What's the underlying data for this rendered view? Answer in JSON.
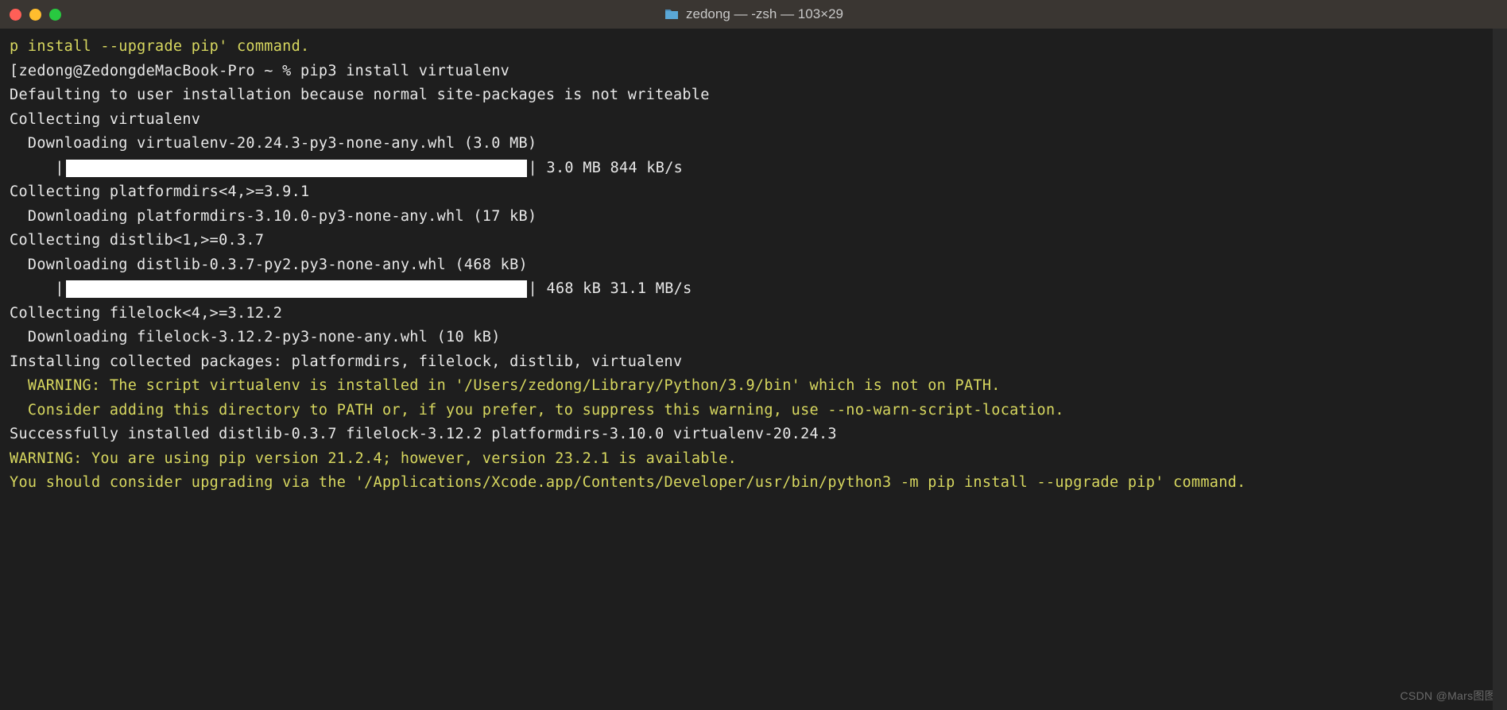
{
  "window": {
    "title": "zedong — -zsh — 103×29"
  },
  "terminal": {
    "lines": [
      {
        "cls": "yellow",
        "text": "p install --upgrade pip' command."
      },
      {
        "cls": "white",
        "text": "[zedong@ZedongdeMacBook-Pro ~ % pip3 install virtualenv"
      },
      {
        "cls": "white",
        "text": "Defaulting to user installation because normal site-packages is not writeable"
      },
      {
        "cls": "white",
        "text": "Collecting virtualenv"
      },
      {
        "cls": "white",
        "text": "  Downloading virtualenv-20.24.3-py3-none-any.whl (3.0 MB)"
      },
      {
        "cls": "white",
        "type": "progress",
        "prefix": "     |",
        "suffix": "| 3.0 MB 844 kB/s"
      },
      {
        "cls": "white",
        "text": "Collecting platformdirs<4,>=3.9.1"
      },
      {
        "cls": "white",
        "text": "  Downloading platformdirs-3.10.0-py3-none-any.whl (17 kB)"
      },
      {
        "cls": "white",
        "text": "Collecting distlib<1,>=0.3.7"
      },
      {
        "cls": "white",
        "text": "  Downloading distlib-0.3.7-py2.py3-none-any.whl (468 kB)"
      },
      {
        "cls": "white",
        "type": "progress",
        "prefix": "     |",
        "suffix": "| 468 kB 31.1 MB/s"
      },
      {
        "cls": "white",
        "text": "Collecting filelock<4,>=3.12.2"
      },
      {
        "cls": "white",
        "text": "  Downloading filelock-3.12.2-py3-none-any.whl (10 kB)"
      },
      {
        "cls": "white",
        "text": "Installing collected packages: platformdirs, filelock, distlib, virtualenv"
      },
      {
        "cls": "yellow",
        "text": "  WARNING: The script virtualenv is installed in '/Users/zedong/Library/Python/3.9/bin' which is not on PATH."
      },
      {
        "cls": "yellow",
        "text": "  Consider adding this directory to PATH or, if you prefer, to suppress this warning, use --no-warn-script-location."
      },
      {
        "cls": "white",
        "text": "Successfully installed distlib-0.3.7 filelock-3.12.2 platformdirs-3.10.0 virtualenv-20.24.3"
      },
      {
        "cls": "yellow",
        "text": "WARNING: You are using pip version 21.2.4; however, version 23.2.1 is available."
      },
      {
        "cls": "yellow",
        "text": "You should consider upgrading via the '/Applications/Xcode.app/Contents/Developer/usr/bin/python3 -m pip install --upgrade pip' command."
      }
    ]
  },
  "watermark": "CSDN @Mars图图"
}
